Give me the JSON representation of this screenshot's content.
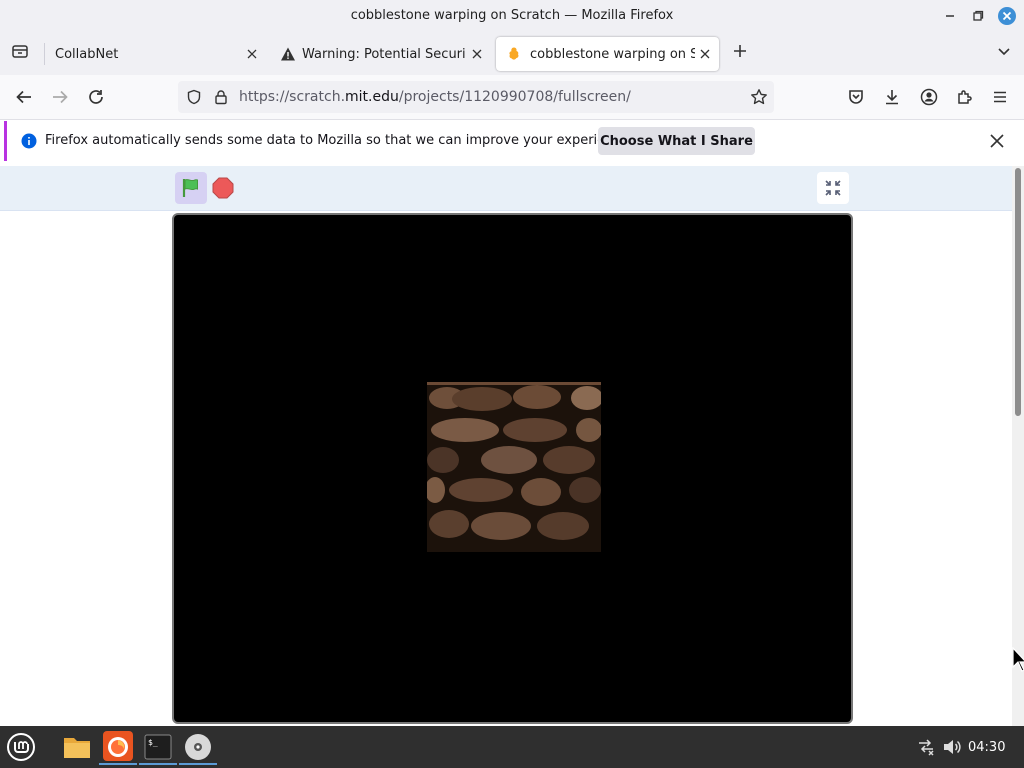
{
  "window": {
    "title": "cobblestone warping on Scratch — Mozilla Firefox"
  },
  "tabs": [
    {
      "label": "CollabNet",
      "active": false,
      "icon": "tab-list-icon"
    },
    {
      "label": "Warning: Potential Security Risk Ahead",
      "active": false,
      "icon": "warning-icon"
    },
    {
      "label": "cobblestone warping on Scratch",
      "active": true,
      "icon": "scratch-favicon"
    }
  ],
  "navbar": {
    "url_prefix": "https://scratch.",
    "url_domain": "mit.edu",
    "url_path": "/projects/1120990708/fullscreen/"
  },
  "notification": {
    "message": "Firefox automatically sends some data to Mozilla so that we can improve your experience.",
    "button": "Choose What I Share"
  },
  "taskbar": {
    "clock": "04:30"
  },
  "colors": {
    "accent_purple": "#b833e1",
    "info_blue": "#0060df",
    "flag_green": "#4cbf56",
    "stop_red": "#ec5959"
  }
}
